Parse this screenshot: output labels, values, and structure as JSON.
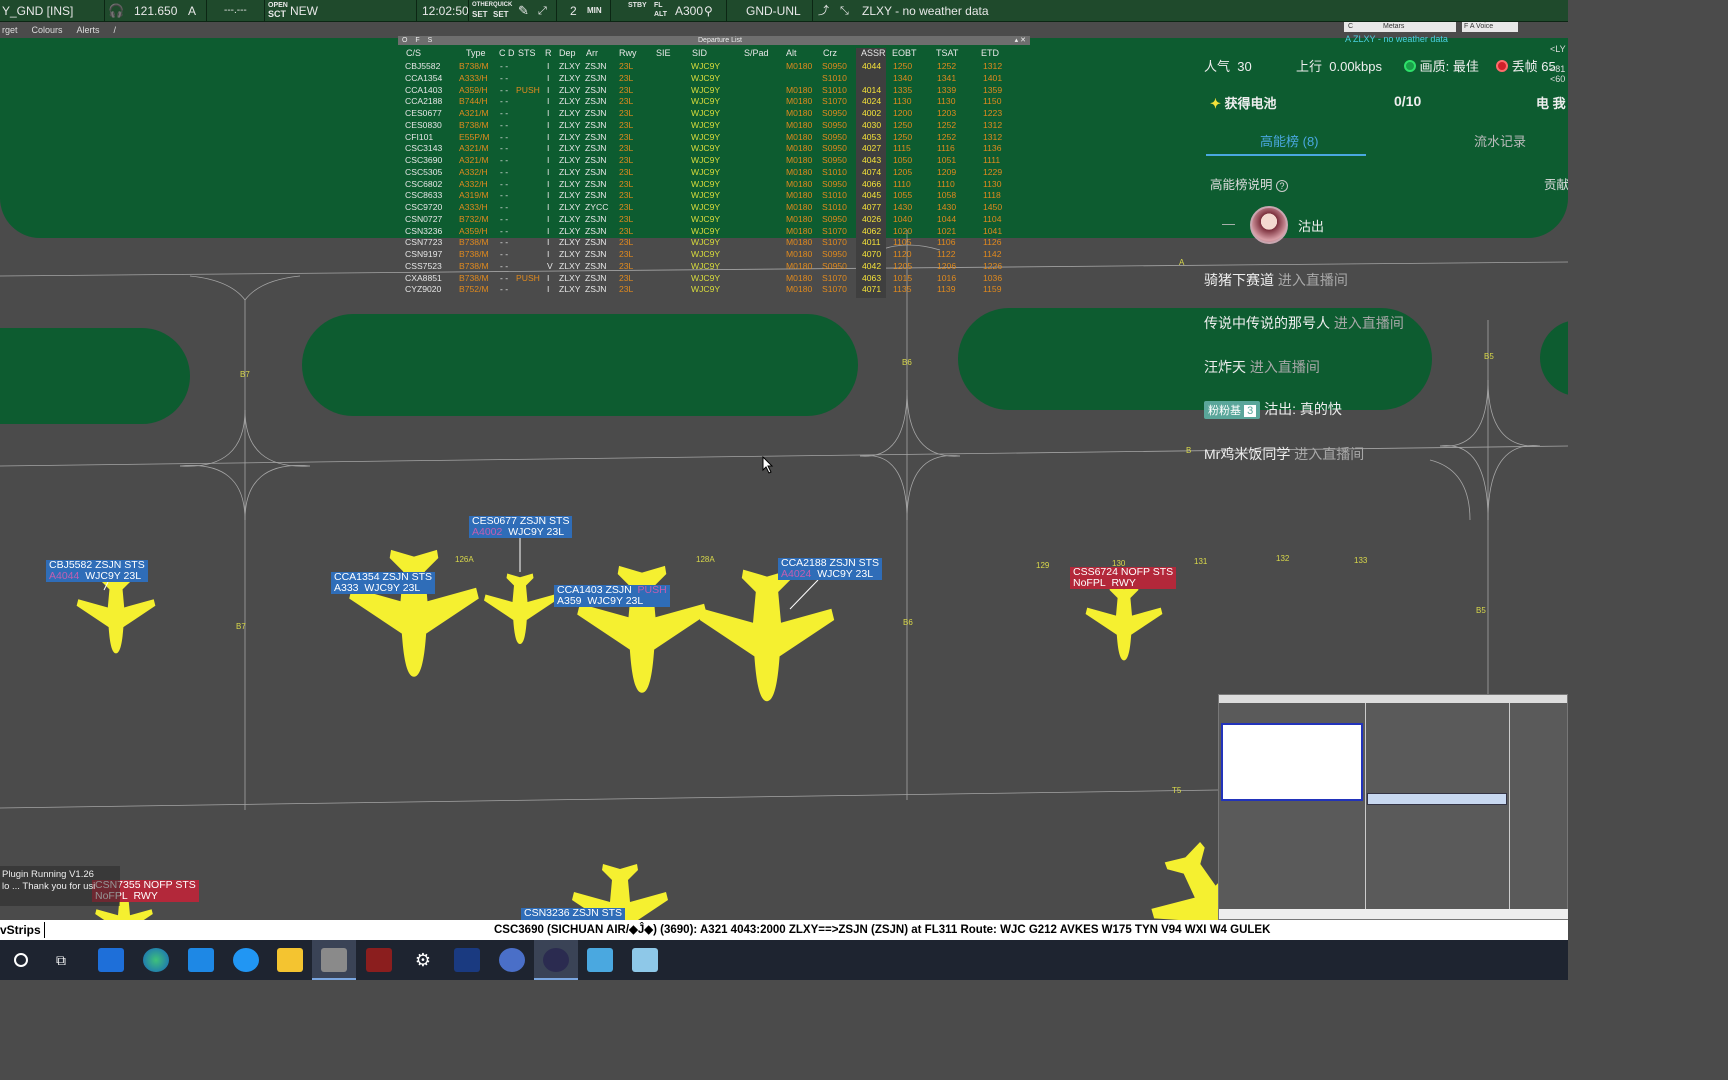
{
  "toolbar": {
    "position": "Y_GND [INS]",
    "frequency": "121.650",
    "atis_letter": "A",
    "dashes": "---.---",
    "open_sct_1": "OPEN",
    "open_sct_2": "SCT",
    "new_label": "NEW",
    "time": "12:02:50",
    "other_1": "OTHER",
    "other_2": "SET",
    "quick_1": "QUICK",
    "quick_2": "SET",
    "count": "2",
    "min": "MIN",
    "stby_1": "STBY",
    "fl_1": "FL",
    "fl_2": "ALT",
    "altitude": "A300",
    "gnd_unl": "GND-UNL",
    "weather": "ZLXY - no weather data",
    "stby_2": "...",
    "fl_top": "FL"
  },
  "menu": [
    "rget",
    "Colours",
    "Alerts",
    "/"
  ],
  "departure_list": {
    "title": "Departure List",
    "left_marks": "O F S",
    "headers": [
      "C/S",
      "Type",
      "C D",
      "STS",
      "R",
      "Dep",
      "Arr",
      "Rwy",
      "SIE",
      "SID",
      "S/Pad",
      "Alt",
      "Crz",
      "ASSR",
      "EOBT",
      "TSAT",
      "ETD"
    ],
    "rows": [
      {
        "cs": "CBJ5582",
        "type": "B738/M",
        "cd": "- -",
        "sts": "",
        "r": "I",
        "dep": "ZLXY",
        "arr": "ZSJN",
        "rwy": "23L",
        "sid": "WJC9Y",
        "alt": "M0180",
        "crz": "S0950",
        "assr": "4044",
        "eobt": "1250",
        "tsat": "1252",
        "etd": "1312"
      },
      {
        "cs": "CCA1354",
        "type": "A333/H",
        "cd": "- -",
        "sts": "",
        "r": "I",
        "dep": "ZLXY",
        "arr": "ZSJN",
        "rwy": "23L",
        "sid": "WJC9Y",
        "alt": "",
        "crz": "S1010",
        "assr": "",
        "eobt": "1340",
        "tsat": "1341",
        "etd": "1401"
      },
      {
        "cs": "CCA1403",
        "type": "A359/H",
        "cd": "- -",
        "sts": "PUSH",
        "r": "I",
        "dep": "ZLXY",
        "arr": "ZSJN",
        "rwy": "23L",
        "sid": "WJC9Y",
        "alt": "M0180",
        "crz": "S1010",
        "assr": "4014",
        "eobt": "1335",
        "tsat": "1339",
        "etd": "1359"
      },
      {
        "cs": "CCA2188",
        "type": "B744/H",
        "cd": "- -",
        "sts": "",
        "r": "I",
        "dep": "ZLXY",
        "arr": "ZSJN",
        "rwy": "23L",
        "sid": "WJC9Y",
        "alt": "M0180",
        "crz": "S1070",
        "assr": "4024",
        "eobt": "1130",
        "tsat": "1130",
        "etd": "1150"
      },
      {
        "cs": "CES0677",
        "type": "A321/M",
        "cd": "- -",
        "sts": "",
        "r": "I",
        "dep": "ZLXY",
        "arr": "ZSJN",
        "rwy": "23L",
        "sid": "WJC9Y",
        "alt": "M0180",
        "crz": "S0950",
        "assr": "4002",
        "eobt": "1200",
        "tsat": "1203",
        "etd": "1223"
      },
      {
        "cs": "CES0830",
        "type": "B738/M",
        "cd": "- -",
        "sts": "",
        "r": "I",
        "dep": "ZLXY",
        "arr": "ZSJN",
        "rwy": "23L",
        "sid": "WJC9Y",
        "alt": "M0180",
        "crz": "S0950",
        "assr": "4030",
        "eobt": "1250",
        "tsat": "1252",
        "etd": "1312"
      },
      {
        "cs": "CFI101",
        "type": "E55P/M",
        "cd": "- -",
        "sts": "",
        "r": "I",
        "dep": "ZLXY",
        "arr": "ZSJN",
        "rwy": "23L",
        "sid": "WJC9Y",
        "alt": "M0180",
        "crz": "S0950",
        "assr": "4053",
        "eobt": "1250",
        "tsat": "1252",
        "etd": "1312"
      },
      {
        "cs": "CSC3143",
        "type": "A321/M",
        "cd": "- -",
        "sts": "",
        "r": "I",
        "dep": "ZLXY",
        "arr": "ZSJN",
        "rwy": "23L",
        "sid": "WJC9Y",
        "alt": "M0180",
        "crz": "S0950",
        "assr": "4027",
        "eobt": "1115",
        "tsat": "1116",
        "etd": "1136"
      },
      {
        "cs": "CSC3690",
        "type": "A321/M",
        "cd": "- -",
        "sts": "",
        "r": "I",
        "dep": "ZLXY",
        "arr": "ZSJN",
        "rwy": "23L",
        "sid": "WJC9Y",
        "alt": "M0180",
        "crz": "S0950",
        "assr": "4043",
        "eobt": "1050",
        "tsat": "1051",
        "etd": "1111"
      },
      {
        "cs": "CSC5305",
        "type": "A332/H",
        "cd": "- -",
        "sts": "",
        "r": "I",
        "dep": "ZLXY",
        "arr": "ZSJN",
        "rwy": "23L",
        "sid": "WJC9Y",
        "alt": "M0180",
        "crz": "S1010",
        "assr": "4074",
        "eobt": "1205",
        "tsat": "1209",
        "etd": "1229"
      },
      {
        "cs": "CSC6802",
        "type": "A332/H",
        "cd": "- -",
        "sts": "",
        "r": "I",
        "dep": "ZLXY",
        "arr": "ZSJN",
        "rwy": "23L",
        "sid": "WJC9Y",
        "alt": "M0180",
        "crz": "S0950",
        "assr": "4066",
        "eobt": "1110",
        "tsat": "1110",
        "etd": "1130"
      },
      {
        "cs": "CSC8633",
        "type": "A319/M",
        "cd": "- -",
        "sts": "",
        "r": "I",
        "dep": "ZLXY",
        "arr": "ZSJN",
        "rwy": "23L",
        "sid": "WJC9Y",
        "alt": "M0180",
        "crz": "S1010",
        "assr": "4045",
        "eobt": "1055",
        "tsat": "1058",
        "etd": "1118"
      },
      {
        "cs": "CSC9720",
        "type": "A333/H",
        "cd": "- -",
        "sts": "",
        "r": "I",
        "dep": "ZLXY",
        "arr": "ZYCC",
        "rwy": "23L",
        "sid": "WJC9Y",
        "alt": "M0180",
        "crz": "S1010",
        "assr": "4077",
        "eobt": "1430",
        "tsat": "1430",
        "etd": "1450"
      },
      {
        "cs": "CSN0727",
        "type": "B732/M",
        "cd": "- -",
        "sts": "",
        "r": "I",
        "dep": "ZLXY",
        "arr": "ZSJN",
        "rwy": "23L",
        "sid": "WJC9Y",
        "alt": "M0180",
        "crz": "S0950",
        "assr": "4026",
        "eobt": "1040",
        "tsat": "1044",
        "etd": "1104"
      },
      {
        "cs": "CSN3236",
        "type": "A359/H",
        "cd": "- -",
        "sts": "",
        "r": "I",
        "dep": "ZLXY",
        "arr": "ZSJN",
        "rwy": "23L",
        "sid": "WJC9Y",
        "alt": "M0180",
        "crz": "S1070",
        "assr": "4062",
        "eobt": "1020",
        "tsat": "1021",
        "etd": "1041"
      },
      {
        "cs": "CSN7723",
        "type": "B738/M",
        "cd": "- -",
        "sts": "",
        "r": "I",
        "dep": "ZLXY",
        "arr": "ZSJN",
        "rwy": "23L",
        "sid": "WJC9Y",
        "alt": "M0180",
        "crz": "S1070",
        "assr": "4011",
        "eobt": "1105",
        "tsat": "1106",
        "etd": "1126"
      },
      {
        "cs": "CSN9197",
        "type": "B738/M",
        "cd": "- -",
        "sts": "",
        "r": "I",
        "dep": "ZLXY",
        "arr": "ZSJN",
        "rwy": "23L",
        "sid": "WJC9Y",
        "alt": "M0180",
        "crz": "S0950",
        "assr": "4070",
        "eobt": "1120",
        "tsat": "1122",
        "etd": "1142"
      },
      {
        "cs": "CSS7523",
        "type": "B738/M",
        "cd": "- -",
        "sts": "",
        "r": "V",
        "dep": "ZLXY",
        "arr": "ZSJN",
        "rwy": "23L",
        "sid": "WJC9Y",
        "alt": "M0180",
        "crz": "S0950",
        "assr": "4042",
        "eobt": "1205",
        "tsat": "1206",
        "etd": "1226"
      },
      {
        "cs": "CXA8851",
        "type": "B738/M",
        "cd": "- -",
        "sts": "PUSH",
        "r": "I",
        "dep": "ZLXY",
        "arr": "ZSJN",
        "rwy": "23L",
        "sid": "WJC9Y",
        "alt": "M0180",
        "crz": "S1070",
        "assr": "4063",
        "eobt": "1015",
        "tsat": "1016",
        "etd": "1036"
      },
      {
        "cs": "CYZ9020",
        "type": "B752/M",
        "cd": "- -",
        "sts": "",
        "r": "I",
        "dep": "ZLXY",
        "arr": "ZSJN",
        "rwy": "23L",
        "sid": "WJC9Y",
        "alt": "M0180",
        "crz": "S1070",
        "assr": "4071",
        "eobt": "1135",
        "tsat": "1139",
        "etd": "1159"
      }
    ]
  },
  "metars": {
    "title": "Metars",
    "text": "A ZLXY - no weather data",
    "voice": "F A Voice"
  },
  "stream_overlay": {
    "popularity_label": "人气",
    "popularity_value": "30",
    "upload_label": "上行",
    "upload_value": "0.00kbps",
    "quality_label": "画质: 最佳",
    "drop_label": "丢帧 65",
    "battery_label": "获得电池",
    "battery_value": "0/10",
    "charge_label": "电 我",
    "tab_rank": "高能榜 (8)",
    "tab_flow": "流水记录",
    "rank_desc": "高能榜说明",
    "contrib": "贡献",
    "dash": "—",
    "top_user": "沽出",
    "chat": [
      {
        "user": "骑猪下赛道",
        "action": "进入直播间"
      },
      {
        "user": "传说中传说的那号人",
        "action": "进入直播间"
      },
      {
        "user": "汪炸天",
        "action": "进入直播间"
      },
      {
        "badge": "粉粉基",
        "level": "3",
        "user": "沽出: 真的快"
      },
      {
        "user": "Mr鸡米饭同学",
        "action": "进入直播间"
      }
    ],
    "side_labels": [
      "<LY",
      "<81",
      "<60"
    ]
  },
  "aircraft_tags": [
    {
      "l1": "CBJ5582  ZSJN  STS",
      "l2a": "A4044",
      "l2b": "WJC9Y  23L",
      "color": "blue"
    },
    {
      "l1": "CES0677  ZSJN  STS",
      "l2a": "A4002",
      "l2b": "WJC9Y  23L",
      "color": "blue"
    },
    {
      "l1": "CCA1354  ZSJN  STS",
      "l2a": "A333",
      "l2b": "WJC9Y  23L",
      "color": "blue"
    },
    {
      "l1": "CCA1403  ZSJN",
      "l1b": "PUSH",
      "l2a": "A359",
      "l2b": "WJC9Y  23L",
      "color": "blue"
    },
    {
      "l1": "CCA2188  ZSJN  STS",
      "l2a": "A4024",
      "l2b": "WJC9Y  23L",
      "color": "blue"
    },
    {
      "l1": "CSS6724  NOFP  STS",
      "l2a": "NoFPL",
      "l2b": "RWY",
      "color": "red"
    },
    {
      "l1": "CSN7355  NOFP  STS",
      "l2a": "NoFPL",
      "l2b": "RWY",
      "color": "red"
    },
    {
      "l1": "CSN3236  ZSJN  STS",
      "l2a": "",
      "l2b": "",
      "color": "blue"
    }
  ],
  "taxiway_labels": [
    "B7",
    "B6",
    "B5",
    "B7",
    "B6",
    "B5",
    "126A",
    "128A",
    "129",
    "130",
    "131",
    "132",
    "133",
    "T5",
    "A",
    "B"
  ],
  "plugin_text": [
    "Plugin Running V1.26",
    "lo ... Thank you for usi"
  ],
  "command_bar": {
    "label": "vStrips",
    "info": "CSC3690 (SICHUAN AIR/◆Ĵ◆) (3690): A321 4043:2000 ZLXY==>ZSJN (ZSJN) at FL311 Route: WJC G212 AVKES W175 TYN V94 WXI W4 GULEK"
  },
  "colors": {
    "grass": "#0d5c30",
    "apron": "#4b4b4b",
    "toolbar": "#1f4a2c",
    "tag_blue": "#2f6db8",
    "tag_red": "#b3283a",
    "aircraft": "#f5f030"
  }
}
